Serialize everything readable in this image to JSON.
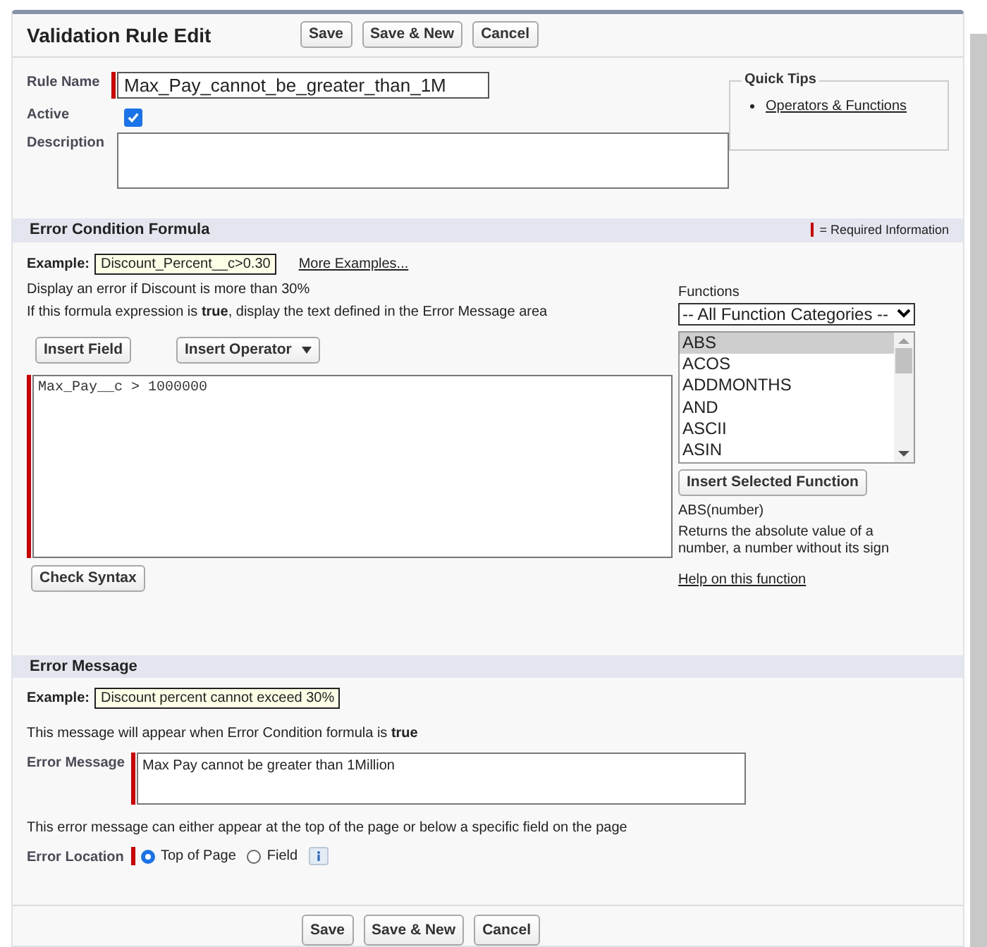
{
  "window": {
    "title": "Validation Rule Edit"
  },
  "top_buttons": [
    "Save",
    "Save & New",
    "Cancel"
  ],
  "rule_name": {
    "label": "Rule Name",
    "value": "Max_Pay_cannot_be_greater_than_1M",
    "required": true
  },
  "active": {
    "label": "Active",
    "checked": true
  },
  "description": {
    "label": "Description"
  },
  "quick_tips": {
    "title": "Quick Tips",
    "links": [
      "Operators & Functions"
    ]
  },
  "formula_section": {
    "title": "Error Condition Formula",
    "required_legend": "= Required Information",
    "example_label": "Example:",
    "example": "Discount_Percent__c>0.30",
    "more_examples": "More Examples...",
    "example_note": "Display an error if Discount is more than 30%",
    "instruction": "If this formula expression is **true**, display the text defined in the Error Message area",
    "insert_field": "Insert Field",
    "insert_operator": "Insert Operator",
    "formula": "Max_Pay__c > 1000000",
    "formula_required": true,
    "check_syntax": "Check Syntax",
    "functions": {
      "label": "Functions",
      "category": "-- All Function Categories --",
      "items": [
        {
          "name": "ABS",
          "selected": true
        },
        {
          "name": "ACOS",
          "selected": false
        },
        {
          "name": "ADDMONTHS",
          "selected": false
        },
        {
          "name": "AND",
          "selected": false
        },
        {
          "name": "ASCII",
          "selected": false
        },
        {
          "name": "ASIN",
          "selected": false
        }
      ],
      "insert_button": "Insert Selected Function",
      "signature": "ABS(number)",
      "description": "Returns the absolute value of a number, a number without its sign",
      "help_link": "Help on this function"
    }
  },
  "message_section": {
    "title": "Error Message",
    "example_label": "Example:",
    "example": "Discount percent cannot exceed 30%",
    "note": "This message will appear when Error Condition formula is **true**",
    "message_label": "Error Message",
    "message": "Max Pay cannot be greater than 1Million",
    "message_required": true,
    "location_note": "This error message can either appear at the top of the page or below a specific field on the page",
    "location_label": "Error Location",
    "location_required": true,
    "locations": [
      {
        "label": "Top of Page",
        "selected": true
      },
      {
        "label": "Field",
        "selected": false
      }
    ]
  },
  "bottom_buttons": [
    "Save",
    "Save & New",
    "Cancel"
  ]
}
